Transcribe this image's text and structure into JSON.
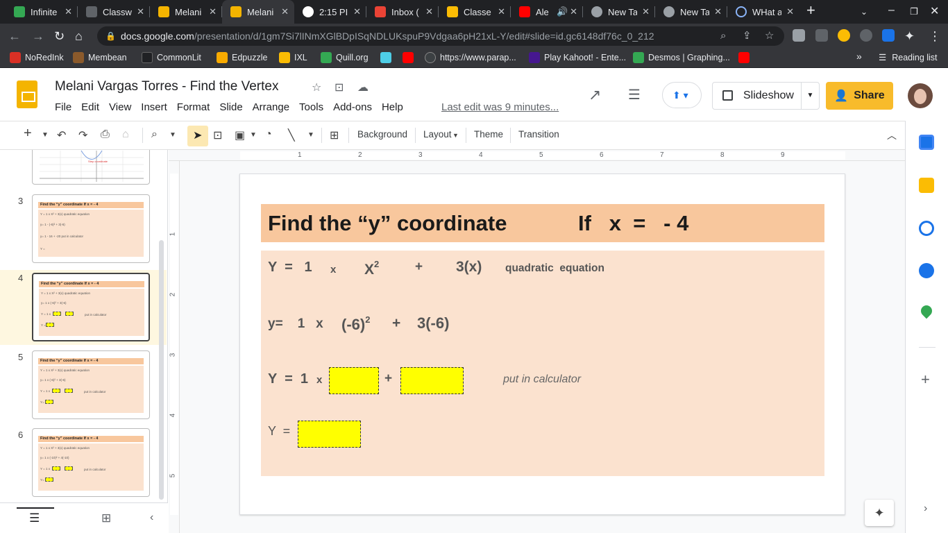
{
  "browser": {
    "tabs": [
      {
        "title": "Infinite",
        "color": "#34a853"
      },
      {
        "title": "Classw",
        "color": "#5f6368"
      },
      {
        "title": "Melani",
        "color": "#f4b400"
      },
      {
        "title": "Melani",
        "color": "#f4b400"
      },
      {
        "title": "2:15 PI",
        "color": "#ffffff"
      },
      {
        "title": "Inbox (",
        "color": "#ea4335"
      },
      {
        "title": "Classe",
        "color": "#fbbc04"
      },
      {
        "title": "Ale",
        "color": "#ff0000"
      },
      {
        "title": "New Ta",
        "color": "#9aa0a6"
      },
      {
        "title": "New Ta",
        "color": "#9aa0a6"
      },
      {
        "title": "WHat a",
        "color": "#8ab4f8"
      }
    ],
    "url_host": "docs.google.com",
    "url_path": "/presentation/d/1gm7Si7lINmXGlBDpISqNDLUKspuP9Vdgaa6pH21xL-Y/edit#slide=id.gc6148df76c_0_212",
    "bookmarks": [
      {
        "label": "NoRedInk",
        "color": "#d93025"
      },
      {
        "label": "Membean",
        "color": "#8b5a2b"
      },
      {
        "label": "CommonLit",
        "color": "#202124"
      },
      {
        "label": "Edpuzzle",
        "color": "#f9ab00"
      },
      {
        "label": "IXL",
        "color": "#fbbc04"
      },
      {
        "label": "Quill.org",
        "color": "#34a853"
      },
      {
        "label": "",
        "color": "#4ecde6"
      },
      {
        "label": "",
        "color": "#ff0000"
      },
      {
        "label": "https://www.parap...",
        "color": "#3c4043"
      },
      {
        "label": "Play Kahoot! - Ente...",
        "color": "#46178f"
      },
      {
        "label": "Desmos | Graphing...",
        "color": "#34a853"
      },
      {
        "label": "",
        "color": "#ff0000"
      }
    ],
    "reading_list": "Reading list"
  },
  "doc": {
    "title": "Melani Vargas Torres - Find  the  Vertex",
    "menu": [
      "File",
      "Edit",
      "View",
      "Insert",
      "Format",
      "Slide",
      "Arrange",
      "Tools",
      "Add-ons",
      "Help"
    ],
    "last_edit": "Last edit was 9 minutes...",
    "slideshow": "Slideshow",
    "share": "Share"
  },
  "toolbar": {
    "background": "Background",
    "layout": "Layout",
    "theme": "Theme",
    "transition": "Transition"
  },
  "ruler": {
    "h": [
      "1",
      "2",
      "3",
      "4",
      "5",
      "6",
      "7",
      "8",
      "9"
    ],
    "v": [
      "1",
      "2",
      "3",
      "4",
      "5"
    ]
  },
  "thumbnails": [
    {
      "num": "3"
    },
    {
      "num": "4"
    },
    {
      "num": "5"
    },
    {
      "num": "6"
    }
  ],
  "slide": {
    "title": "Find the “y” coordinate",
    "title_if": "If   x  =   - 4",
    "row1": {
      "y": "Y  =   1",
      "x": "x",
      "x2": "X",
      "exp": "2",
      "plus": "+",
      "term": "3(x)",
      "label": "quadratic  equation"
    },
    "row2": {
      "lhs": "y=    1   x",
      "paren": "(-6)",
      "exp": "2",
      "plus": "+",
      "term": "3(-6)"
    },
    "row3": {
      "lhs": "Y  =  1",
      "x": "x",
      "plus": "+",
      "note": "put in calculator"
    },
    "row4": {
      "lhs": "Y  ="
    },
    "thumb_lines": {
      "title": "Find the “y” coordinate        If  x =  - 4",
      "t3": [
        "Y =  1    x     X²      +     3(x)    quadratic equation",
        "y=  1    -  (-6)²    +    3(-6)",
        "y=  1    -   16    +    -20              put in calculator",
        "Y ="
      ],
      "t4": [
        "Y = 1   x   X²   +    3(x)    quadratic equation",
        "y=  1  x  (-6)²  +  3(-6)",
        "Y = 1 x",
        "put in calculator",
        "Y ="
      ],
      "t5": [
        "Y =  1    x    X²     +     3(x)    quadratic equation",
        "y= 1 x (-6)² +  3(-6)",
        "Y = 1 x",
        "put in calculator",
        "Y="
      ],
      "t6": [
        "Y =  1    x    X²     +     3(x)   quadratic equation",
        "y= 1 x (-10)² +  4(-10)",
        "Y = 1 x",
        "put in calculator",
        "Y="
      ]
    }
  }
}
